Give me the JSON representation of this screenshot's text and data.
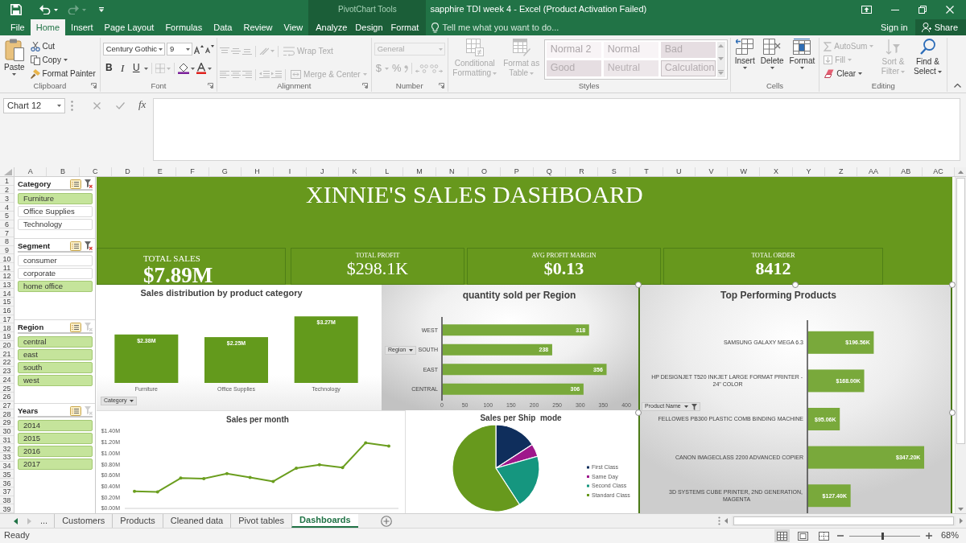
{
  "title_bar": {
    "tool_context": "PivotChart Tools",
    "title": "sapphire TDI week 4 - Excel (Product Activation Failed)"
  },
  "menu_tabs": [
    {
      "label": "File",
      "selected": false,
      "contextual": false
    },
    {
      "label": "Home",
      "selected": true,
      "contextual": false
    },
    {
      "label": "Insert",
      "selected": false,
      "contextual": false
    },
    {
      "label": "Page Layout",
      "selected": false,
      "contextual": false
    },
    {
      "label": "Formulas",
      "selected": false,
      "contextual": false
    },
    {
      "label": "Data",
      "selected": false,
      "contextual": false
    },
    {
      "label": "Review",
      "selected": false,
      "contextual": false
    },
    {
      "label": "View",
      "selected": false,
      "contextual": false
    },
    {
      "label": "Analyze",
      "selected": false,
      "contextual": true
    },
    {
      "label": "Design",
      "selected": false,
      "contextual": true
    },
    {
      "label": "Format",
      "selected": false,
      "contextual": true
    }
  ],
  "tell_me": {
    "placeholder": "Tell me what you want to do..."
  },
  "account": {
    "sign_in": "Sign in",
    "share": "Share"
  },
  "ribbon_groups": [
    {
      "kind": "clipboard",
      "label": "Clipboard",
      "launcher": true,
      "disabled": false,
      "paste": "Paste",
      "items": [
        "Cut",
        "Copy",
        "Format Painter"
      ]
    },
    {
      "kind": "font",
      "label": "Font",
      "launcher": true,
      "disabled": false,
      "font_name": "Century Gothic",
      "font_size": "9",
      "styles": [
        "B",
        "I",
        "U"
      ]
    },
    {
      "kind": "alignment",
      "label": "Alignment",
      "launcher": true,
      "disabled": true,
      "wrap_text": "Wrap Text",
      "merge": "Merge & Center"
    },
    {
      "kind": "number",
      "label": "Number",
      "launcher": true,
      "disabled": true,
      "format": "General",
      "symbols": [
        "$",
        "%"
      ]
    },
    {
      "kind": "styles",
      "label": "Styles",
      "launcher": false,
      "disabled": true,
      "conditional": "Conditional Formatting",
      "table": "Format as Table",
      "cell_styles": [
        {
          "label": "Normal 2",
          "kind": "plain"
        },
        {
          "label": "Normal",
          "kind": "plain"
        },
        {
          "label": "Bad",
          "kind": "bad"
        },
        {
          "label": "Good",
          "kind": "good"
        },
        {
          "label": "Neutral",
          "kind": "neutral"
        },
        {
          "label": "Calculation",
          "kind": "calculation"
        }
      ]
    },
    {
      "kind": "cells",
      "label": "Cells",
      "launcher": false,
      "disabled": false,
      "buttons": [
        "Insert",
        "Delete",
        "Format"
      ]
    },
    {
      "kind": "editing",
      "label": "Editing",
      "launcher": false,
      "disabled": false,
      "items": [
        {
          "label": "AutoSum",
          "disabled": true
        },
        {
          "label": "Fill",
          "disabled": true
        },
        {
          "label": "Clear",
          "disabled": false
        },
        {
          "label": "Sort & Filter",
          "disabled": true
        },
        {
          "label": "Find & Select",
          "disabled": false
        }
      ]
    }
  ],
  "formula_bar": {
    "name_box": "Chart 12",
    "function_button": "fx"
  },
  "column_headers": [
    "A",
    "B",
    "C",
    "D",
    "E",
    "F",
    "G",
    "H",
    "I",
    "J",
    "K",
    "L",
    "M",
    "N",
    "O",
    "P",
    "Q",
    "R",
    "S",
    "T",
    "U",
    "V",
    "W",
    "X",
    "Y",
    "Z",
    "AA",
    "AB",
    "AC"
  ],
  "row_numbers": [
    "1",
    "2",
    "3",
    "4",
    "5",
    "6",
    "7",
    "8",
    "9",
    "10",
    "11",
    "12",
    "13",
    "14",
    "15",
    "16",
    "17",
    "18",
    "19",
    "20",
    "21",
    "22",
    "23",
    "24",
    "25",
    "26",
    "27",
    "28",
    "29",
    "30",
    "31",
    "32",
    "33",
    "34",
    "35",
    "36",
    "37",
    "38",
    "39"
  ],
  "slicers": [
    {
      "title": "Category",
      "clear_enabled": true,
      "items": [
        {
          "label": "Furniture",
          "selected": true
        },
        {
          "label": "Office Supplies",
          "selected": false
        },
        {
          "label": "Technology",
          "selected": false
        }
      ]
    },
    {
      "title": "Segment",
      "clear_enabled": true,
      "items": [
        {
          "label": "consumer",
          "selected": false
        },
        {
          "label": "corporate",
          "selected": false
        },
        {
          "label": "home office",
          "selected": true
        }
      ]
    },
    {
      "title": "Region",
      "clear_enabled": false,
      "items": [
        {
          "label": "central",
          "selected": true
        },
        {
          "label": "east",
          "selected": true
        },
        {
          "label": "south",
          "selected": true
        },
        {
          "label": "west",
          "selected": true
        }
      ]
    },
    {
      "title": "Years",
      "clear_enabled": false,
      "items": [
        {
          "label": "2014",
          "selected": true
        },
        {
          "label": "2015",
          "selected": true
        },
        {
          "label": "2016",
          "selected": true
        },
        {
          "label": "2017",
          "selected": true
        }
      ]
    }
  ],
  "dashboard": {
    "title": "XINNIE'S SALES DASHBOARD",
    "kpis": [
      {
        "label": "TOTAL SALES",
        "value": "$7.89M",
        "bold": true
      },
      {
        "label": "TOTAL PROFIT",
        "value": "$298.1K",
        "bold": false
      },
      {
        "label": "AVG PROFIT MARGIN",
        "value": "$0.13",
        "bold": true
      },
      {
        "label": "TOTAL ORDER",
        "value": "8412",
        "bold": true
      }
    ]
  },
  "charts": [
    {
      "selected": false,
      "field_button": "Category",
      "filter_applied": false,
      "chart_data": {
        "type": "bar",
        "title": "Sales distribution by product category",
        "categories": [
          "Furniture",
          "Office Supplies",
          "Technology"
        ],
        "values": [
          2.38,
          2.25,
          3.27
        ],
        "value_labels": [
          "$2.38M",
          "$2.25M",
          "$3.27M"
        ]
      }
    },
    {
      "selected": false,
      "field_button": "Region",
      "filter_applied": false,
      "chart_data": {
        "type": "bar",
        "orientation": "horizontal",
        "title": "quantity sold per Region",
        "categories": [
          "WEST",
          "SOUTH",
          "EAST",
          "CENTRAL"
        ],
        "values": [
          318,
          238,
          356,
          306
        ],
        "xlim": [
          0,
          400
        ],
        "xticks": [
          0,
          50,
          100,
          150,
          200,
          250,
          300,
          350,
          400
        ],
        "data_labels": true
      }
    },
    {
      "selected": true,
      "field_button": "Product Name",
      "filter_applied": true,
      "chart_data": {
        "type": "bar",
        "orientation": "horizontal",
        "title": "Top Performing Products",
        "categories": [
          "SAMSUNG GALAXY MEGA 6.3",
          "HP DESIGNJET T520 INKJET LARGE FORMAT PRINTER - 24\" COLOR",
          "FELLOWES PB300 PLASTIC COMB BINDING MACHINE",
          "CANON IMAGECLASS 2200 ADVANCED COPIER",
          "3D SYSTEMS CUBE PRINTER, 2ND GENERATION, MAGENTA"
        ],
        "values": [
          196.56,
          168.0,
          95.06,
          347.2,
          127.4
        ],
        "value_labels": [
          "$196.56K",
          "$168.00K",
          "$95.06K",
          "$347.20K",
          "$127.40K"
        ]
      }
    },
    {
      "selected": false,
      "chart_data": {
        "type": "line",
        "title": "Sales per month",
        "categories": [
          null,
          null,
          null,
          null,
          null,
          null,
          null,
          null,
          null,
          null,
          null,
          null
        ],
        "ylim": [
          0,
          1.4
        ],
        "yticks": [
          {
            "value": 0,
            "label": "$0.00M"
          },
          {
            "value": 0.2,
            "label": "$0.20M"
          },
          {
            "value": 0.4,
            "label": "$0.40M"
          },
          {
            "value": 0.6,
            "label": "$0.60M"
          },
          {
            "value": 0.8,
            "label": "$0.80M"
          },
          {
            "value": 1.0,
            "label": "$1.00M"
          },
          {
            "value": 1.2,
            "label": "$1.20M"
          },
          {
            "value": 1.4,
            "label": "$1.40M"
          }
        ],
        "series": [
          {
            "values": [
              0.31,
              0.3,
              0.55,
              0.54,
              0.63,
              0.56,
              0.49,
              0.73,
              0.79,
              0.74,
              1.19,
              1.13
            ]
          }
        ]
      }
    },
    {
      "selected": false,
      "title": "Sales per Ship  mode",
      "legend": [
        {
          "label": "First Class",
          "color": "#0f2e5c"
        },
        {
          "label": "Same Day",
          "color": "#9e178b"
        },
        {
          "label": "Second Class",
          "color": "#15967f"
        },
        {
          "label": "Standard Class",
          "color": "#67991d"
        }
      ]
    }
  ],
  "sheet_tabs": {
    "more": "...",
    "tabs": [
      {
        "label": "Customers",
        "selected": false
      },
      {
        "label": "Products",
        "selected": false
      },
      {
        "label": "Cleaned data",
        "selected": false
      },
      {
        "label": "Pivot tables",
        "selected": false
      },
      {
        "label": "Dashboards",
        "selected": true
      }
    ]
  },
  "status_bar": {
    "status": "Ready",
    "views": [
      {
        "kind": "normal",
        "selected": true
      },
      {
        "kind": "page_layout",
        "selected": false
      },
      {
        "kind": "page_break",
        "selected": false
      }
    ],
    "zoom": {
      "level": 0.47,
      "text": "68%"
    }
  }
}
